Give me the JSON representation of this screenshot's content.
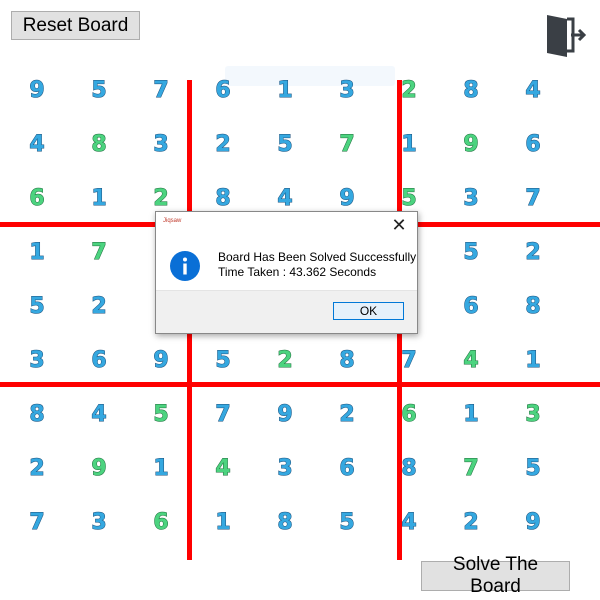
{
  "buttons": {
    "reset": "Reset Board",
    "solve": "Solve The Board"
  },
  "board": {
    "values": [
      [
        9,
        5,
        7,
        6,
        1,
        3,
        2,
        8,
        4
      ],
      [
        4,
        8,
        3,
        2,
        5,
        7,
        1,
        9,
        6
      ],
      [
        6,
        1,
        2,
        8,
        4,
        9,
        5,
        3,
        7
      ],
      [
        1,
        7,
        null,
        null,
        null,
        null,
        null,
        5,
        2
      ],
      [
        5,
        2,
        null,
        null,
        null,
        null,
        null,
        6,
        8
      ],
      [
        3,
        6,
        9,
        5,
        2,
        8,
        7,
        4,
        1
      ],
      [
        8,
        4,
        5,
        7,
        9,
        2,
        6,
        1,
        3
      ],
      [
        2,
        9,
        1,
        4,
        3,
        6,
        8,
        7,
        5
      ],
      [
        7,
        3,
        6,
        1,
        8,
        5,
        4,
        2,
        9
      ]
    ],
    "colors": [
      [
        "blue",
        "blue",
        "blue",
        "blue",
        "blue",
        "blue",
        "green",
        "blue",
        "blue"
      ],
      [
        "blue",
        "green",
        "blue",
        "blue",
        "blue",
        "green",
        "blue",
        "green",
        "blue"
      ],
      [
        "green",
        "blue",
        "green",
        "blue",
        "blue",
        "blue",
        "green",
        "blue",
        "blue"
      ],
      [
        "blue",
        "green",
        "blue",
        "blue",
        "blue",
        "blue",
        "blue",
        "blue",
        "blue"
      ],
      [
        "blue",
        "blue",
        "blue",
        "blue",
        "blue",
        "blue",
        "blue",
        "blue",
        "blue"
      ],
      [
        "blue",
        "blue",
        "blue",
        "blue",
        "green",
        "blue",
        "blue",
        "green",
        "blue"
      ],
      [
        "blue",
        "blue",
        "green",
        "blue",
        "blue",
        "blue",
        "green",
        "blue",
        "green"
      ],
      [
        "blue",
        "green",
        "blue",
        "green",
        "blue",
        "blue",
        "blue",
        "green",
        "blue"
      ],
      [
        "blue",
        "blue",
        "green",
        "blue",
        "blue",
        "blue",
        "blue",
        "blue",
        "blue"
      ]
    ]
  },
  "dialog": {
    "title": "Jiqsaw",
    "message_line1": "Board Has Been Solved Successfully",
    "message_line2": "Time Taken : 43.362 Seconds",
    "ok": "OK",
    "close_symbol": "✕"
  },
  "icons": {
    "exit": "exit-door-icon",
    "info": "info-icon"
  },
  "colors": {
    "grid_lines": "#ff0000",
    "digit_blue": "#35a8e0",
    "digit_green": "#4cd37f",
    "info_blue": "#0a6fd6"
  }
}
